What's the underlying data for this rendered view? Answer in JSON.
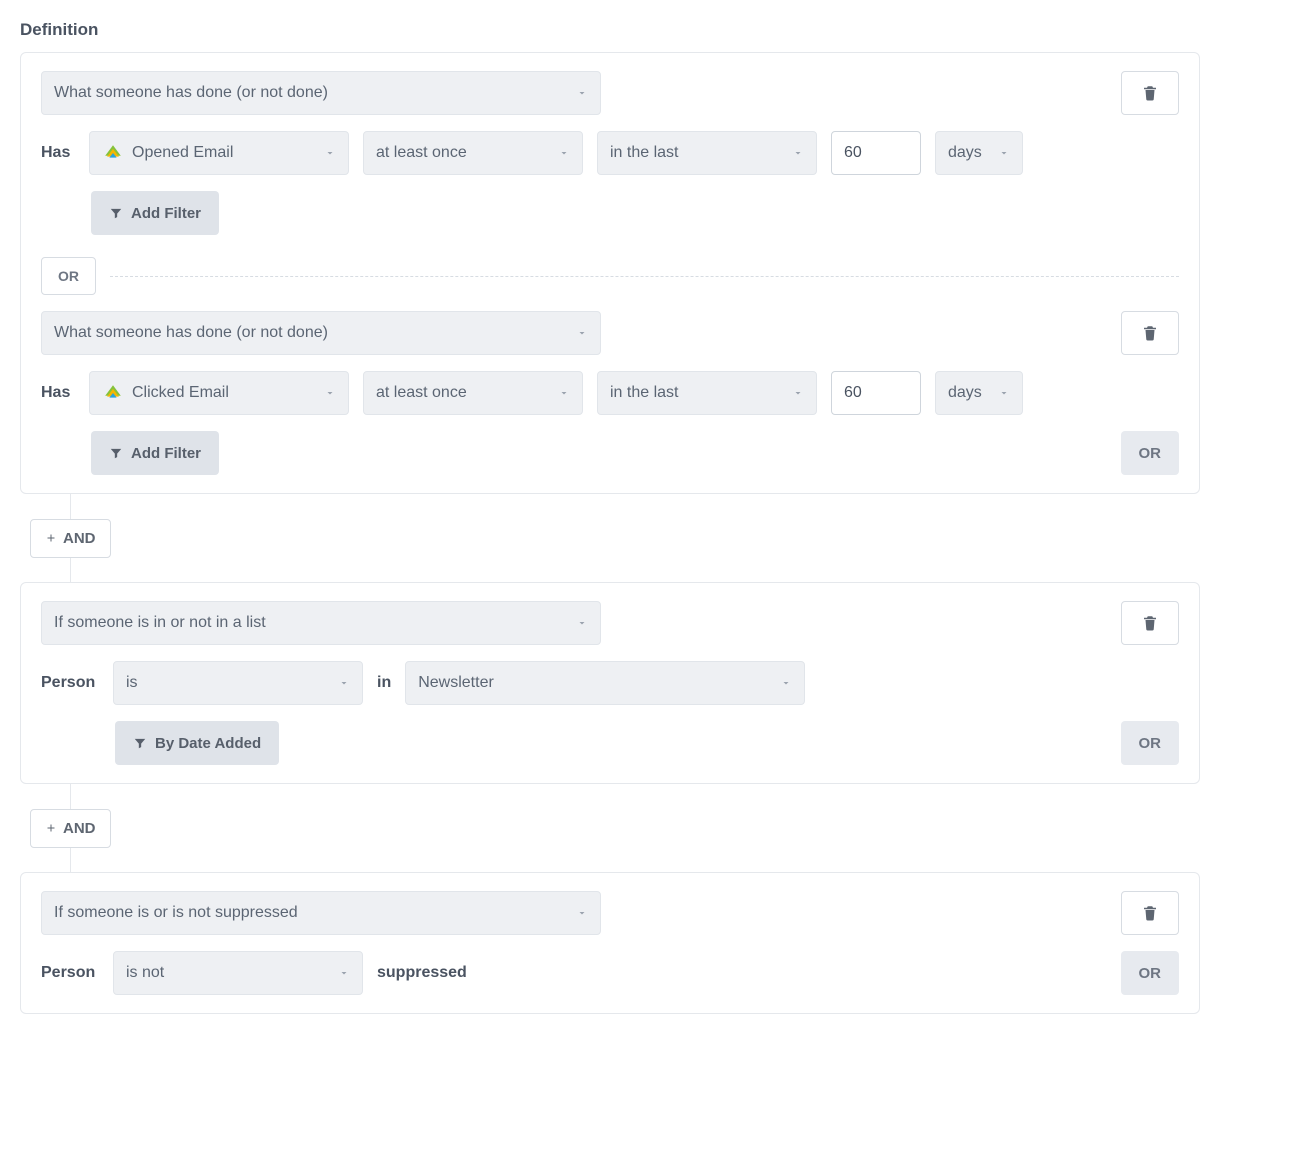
{
  "title": "Definition",
  "labels": {
    "has": "Has",
    "person": "Person",
    "in": "in",
    "suppressed": "suppressed",
    "or": "OR",
    "and": "AND",
    "addFilter": "Add Filter",
    "byDateAdded": "By Date Added"
  },
  "group1": {
    "cond1": {
      "type": "What someone has done (or not done)",
      "event": "Opened Email",
      "frequency": "at least once",
      "range": "in the last",
      "value": "60",
      "unit": "days"
    },
    "cond2": {
      "type": "What someone has done (or not done)",
      "event": "Clicked Email",
      "frequency": "at least once",
      "range": "in the last",
      "value": "60",
      "unit": "days"
    }
  },
  "group2": {
    "type": "If someone is in or not in a list",
    "op": "is",
    "list": "Newsletter"
  },
  "group3": {
    "type": "If someone is or is not suppressed",
    "op": "is not"
  }
}
